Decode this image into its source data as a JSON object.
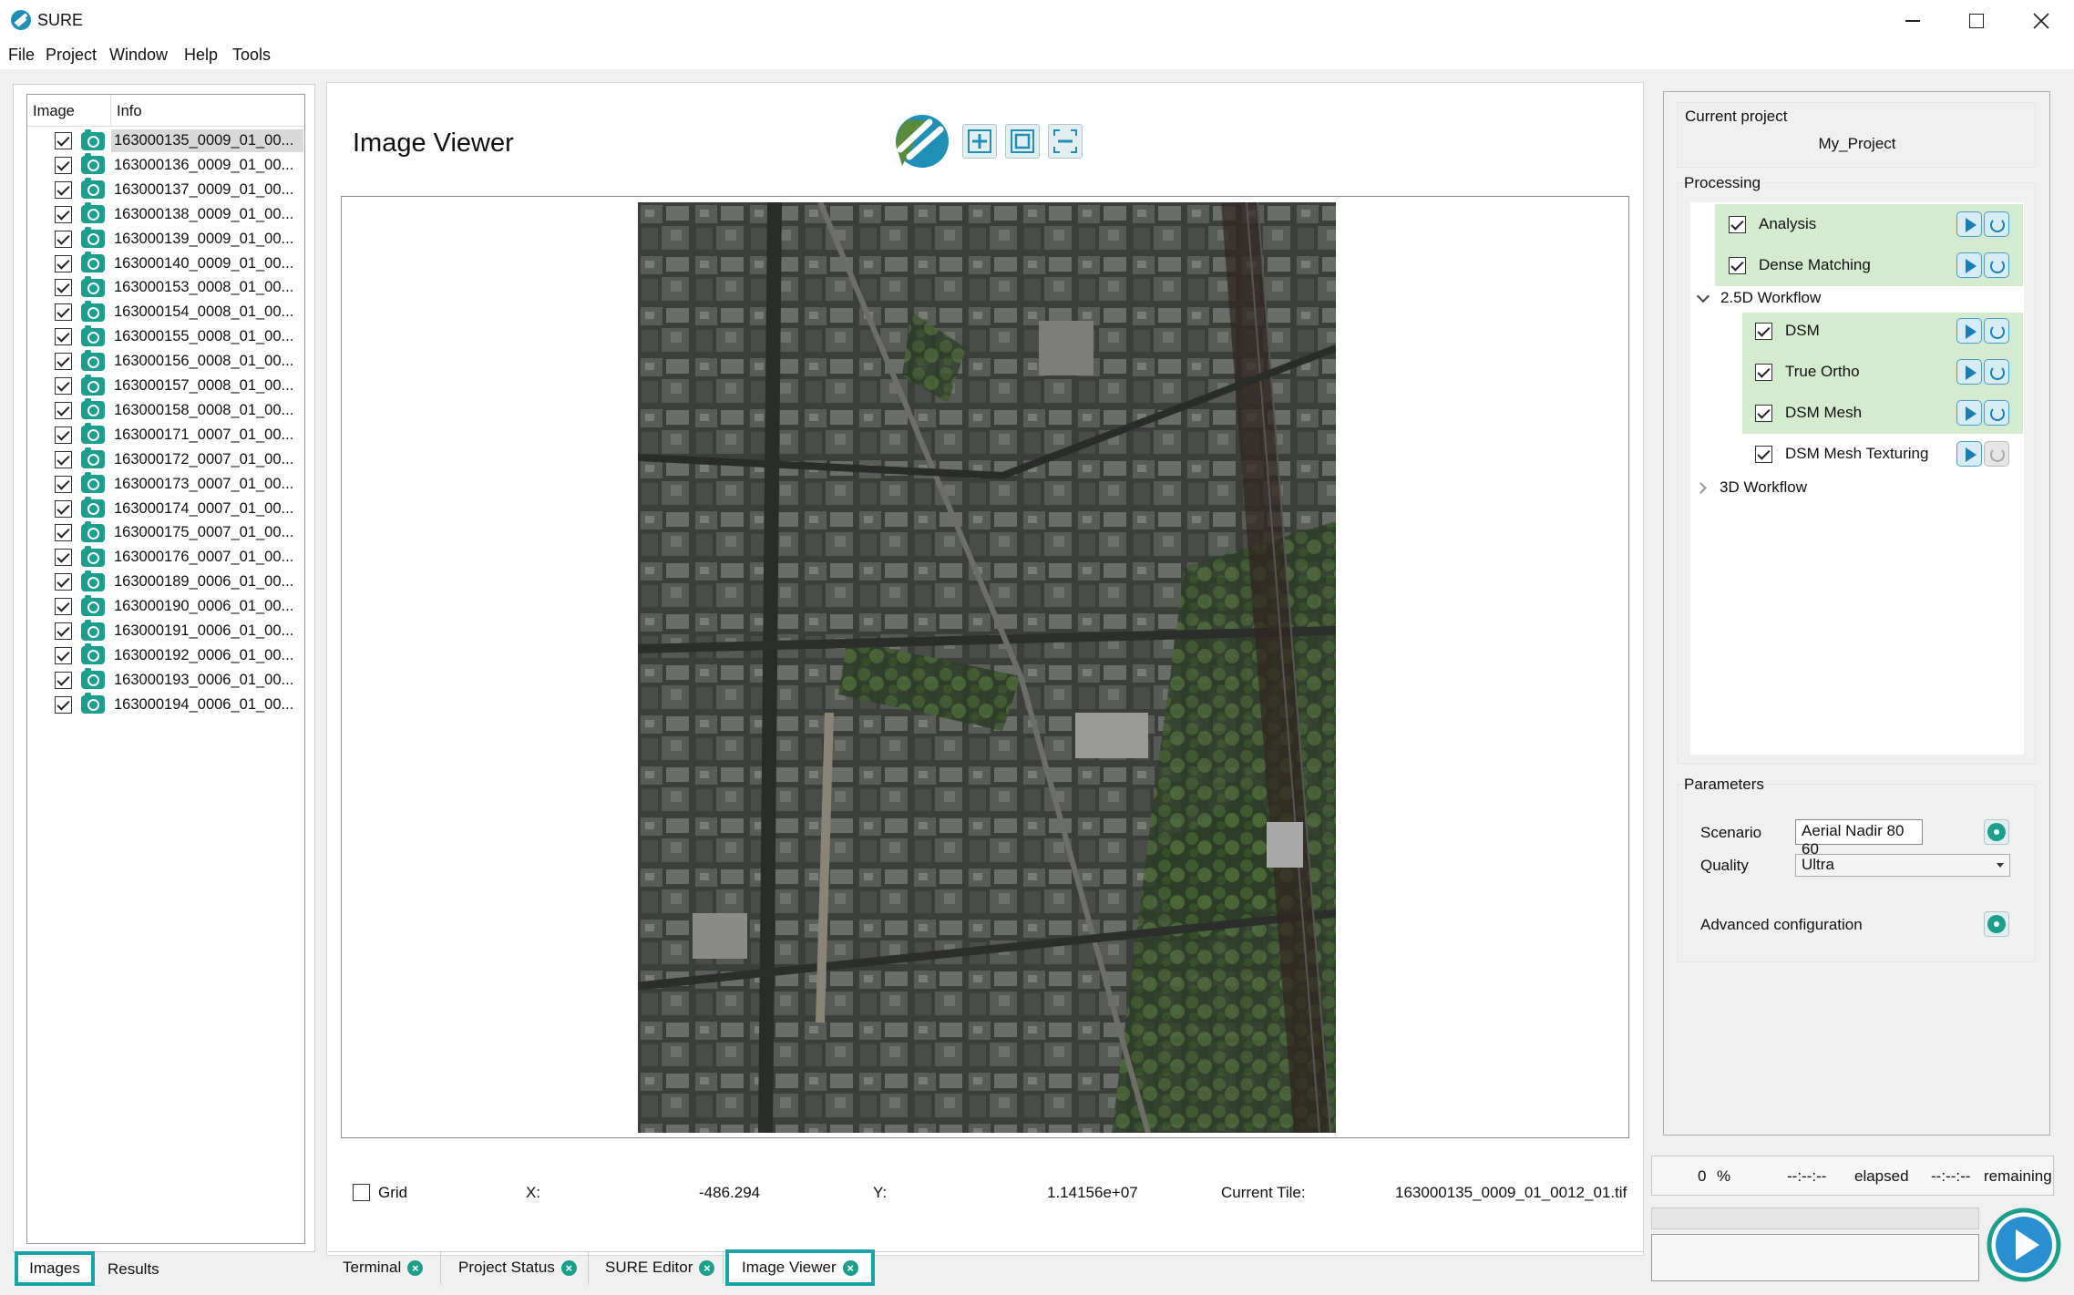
{
  "window": {
    "title": "SURE"
  },
  "menu": [
    "File",
    "Project",
    "Window",
    "Help",
    "Tools"
  ],
  "images_panel": {
    "headers": {
      "image": "Image",
      "info": "Info"
    },
    "rows": [
      "163000135_0009_01_00...",
      "163000136_0009_01_00...",
      "163000137_0009_01_00...",
      "163000138_0009_01_00...",
      "163000139_0009_01_00...",
      "163000140_0009_01_00...",
      "163000153_0008_01_00...",
      "163000154_0008_01_00...",
      "163000155_0008_01_00...",
      "163000156_0008_01_00...",
      "163000157_0008_01_00...",
      "163000158_0008_01_00...",
      "163000171_0007_01_00...",
      "163000172_0007_01_00...",
      "163000173_0007_01_00...",
      "163000174_0007_01_00...",
      "163000175_0007_01_00...",
      "163000176_0007_01_00...",
      "163000189_0006_01_00...",
      "163000190_0006_01_00...",
      "163000191_0006_01_00...",
      "163000192_0006_01_00...",
      "163000193_0006_01_00...",
      "163000194_0006_01_00..."
    ],
    "tabs": [
      "Images",
      "Results"
    ]
  },
  "viewer": {
    "title": "Image Viewer",
    "grid_label": "Grid",
    "x_label": "X:",
    "x_value": "-486.294",
    "y_label": "Y:",
    "y_value": "1.14156e+07",
    "tile_label": "Current Tile:",
    "tile_value": "163000135_0009_01_0012_01.tif"
  },
  "bottom_tabs": [
    "Terminal",
    "Project Status",
    "SURE Editor",
    "Image Viewer"
  ],
  "project": {
    "current_label": "Current project",
    "name": "My_Project",
    "processing_label": "Processing",
    "steps": {
      "analysis": "Analysis",
      "dense_matching": "Dense Matching",
      "workflow_25d": "2.5D Workflow",
      "dsm": "DSM",
      "true_ortho": "True Ortho",
      "dsm_mesh": "DSM Mesh",
      "dsm_mesh_texturing": "DSM Mesh Texturing",
      "workflow_3d": "3D Workflow"
    },
    "parameters_label": "Parameters",
    "scenario_label": "Scenario",
    "scenario_value": "Aerial Nadir 80 60",
    "quality_label": "Quality",
    "quality_value": "Ultra",
    "advanced_label": "Advanced configuration"
  },
  "progress": {
    "percent": "0",
    "percent_sign": "%",
    "elapsed_time": "--:--:--",
    "elapsed_label": "elapsed",
    "remaining_time": "--:--:--",
    "remaining_label": "remaining"
  },
  "colors": {
    "accent": "#1b9e8c",
    "highlight": "#d5ebd0",
    "tab_border": "#1aa3a8"
  }
}
